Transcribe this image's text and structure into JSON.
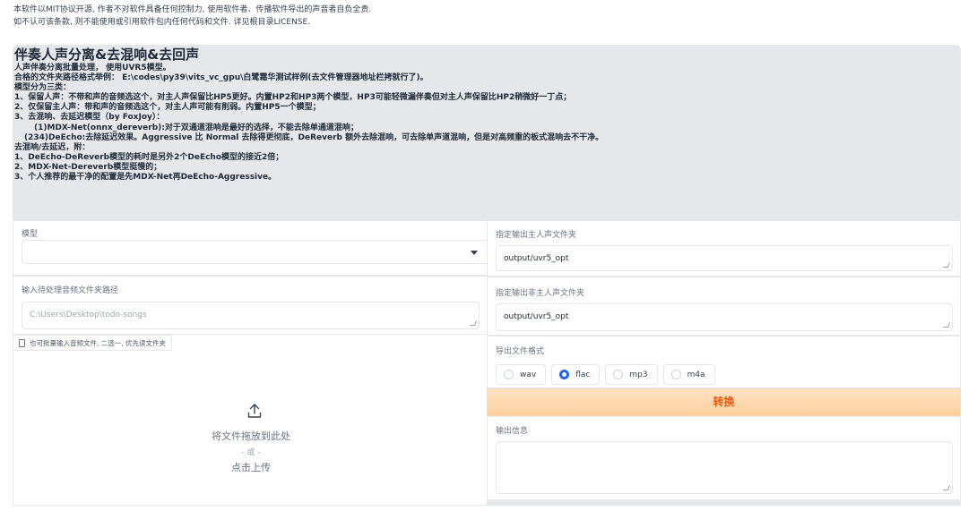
{
  "notice": {
    "line1": "本软件以MIT协议开源, 作者不对软件具备任何控制力, 使用软件者、传播软件导出的声音者自负全责.",
    "line2": "如不认可该条款, 则不能使用或引用软件包内任何代码和文件. 详见根目录LICENSE."
  },
  "info": {
    "title": "伴奏人声分离&去混响&去回声",
    "lines": [
      "人声伴奏分离批量处理， 使用UVR5模型。",
      "合格的文件夹路径格式举例： E:\\codes\\py39\\vits_vc_gpu\\白鹭霜华测试样例(去文件管理器地址栏拷就行了)。",
      "模型分为三类：",
      "1、保留人声：不带和声的音频选这个，对主人声保留比HP5更好。内置HP2和HP3两个模型，HP3可能轻微漏伴奏但对主人声保留比HP2稍微好一丁点；",
      "2、仅保留主人声：带和声的音频选这个，对主人声可能有削弱。内置HP5一个模型；",
      "3、去混响、去延迟模型（by FoxJoy）：",
      "(1)MDX-Net(onnx_dereverb):对于双通道混响是最好的选择，不能去除单通道混响；",
      "(234)DeEcho:去除延迟效果。Aggressive 比 Normal 去除得更彻底，DeReverb 额外去除混响，可去除单声道混响，但是对高频重的板式混响去不干净。",
      "去混响/去延迟，附：",
      "1、DeEcho-DeReverb模型的耗时是另外2个DeEcho模型的接近2倍；",
      "2、MDX-Net-Dereverb模型挺慢的；",
      "3、个人推荐的最干净的配置是先MDX-Net再DeEcho-Aggressive。"
    ]
  },
  "model": {
    "label": "模型",
    "value": ""
  },
  "input_dir": {
    "label": "输入待处理音频文件夹路径",
    "placeholder": "C:\\Users\\Desktop\\todo-songs"
  },
  "upload": {
    "tag": "也可批量输入音频文件, 二选一, 优先读文件夹",
    "drop_text": "将文件拖放到此处",
    "or_text": "- 或 -",
    "click_text": "点击上传"
  },
  "vocal_out": {
    "label": "指定输出主人声文件夹",
    "value": "output/uvr5_opt"
  },
  "ins_out": {
    "label": "指定输出非主人声文件夹",
    "value": "output/uvr5_opt"
  },
  "format": {
    "label": "导出文件格式",
    "options": [
      "wav",
      "flac",
      "mp3",
      "m4a"
    ],
    "selected": "flac"
  },
  "convert_button": "转换",
  "output_info": {
    "label": "输出信息",
    "value": ""
  },
  "colors": {
    "accent": "#ea580c",
    "radio_selected": "#2563eb",
    "info_bg": "#e5e7eb"
  }
}
